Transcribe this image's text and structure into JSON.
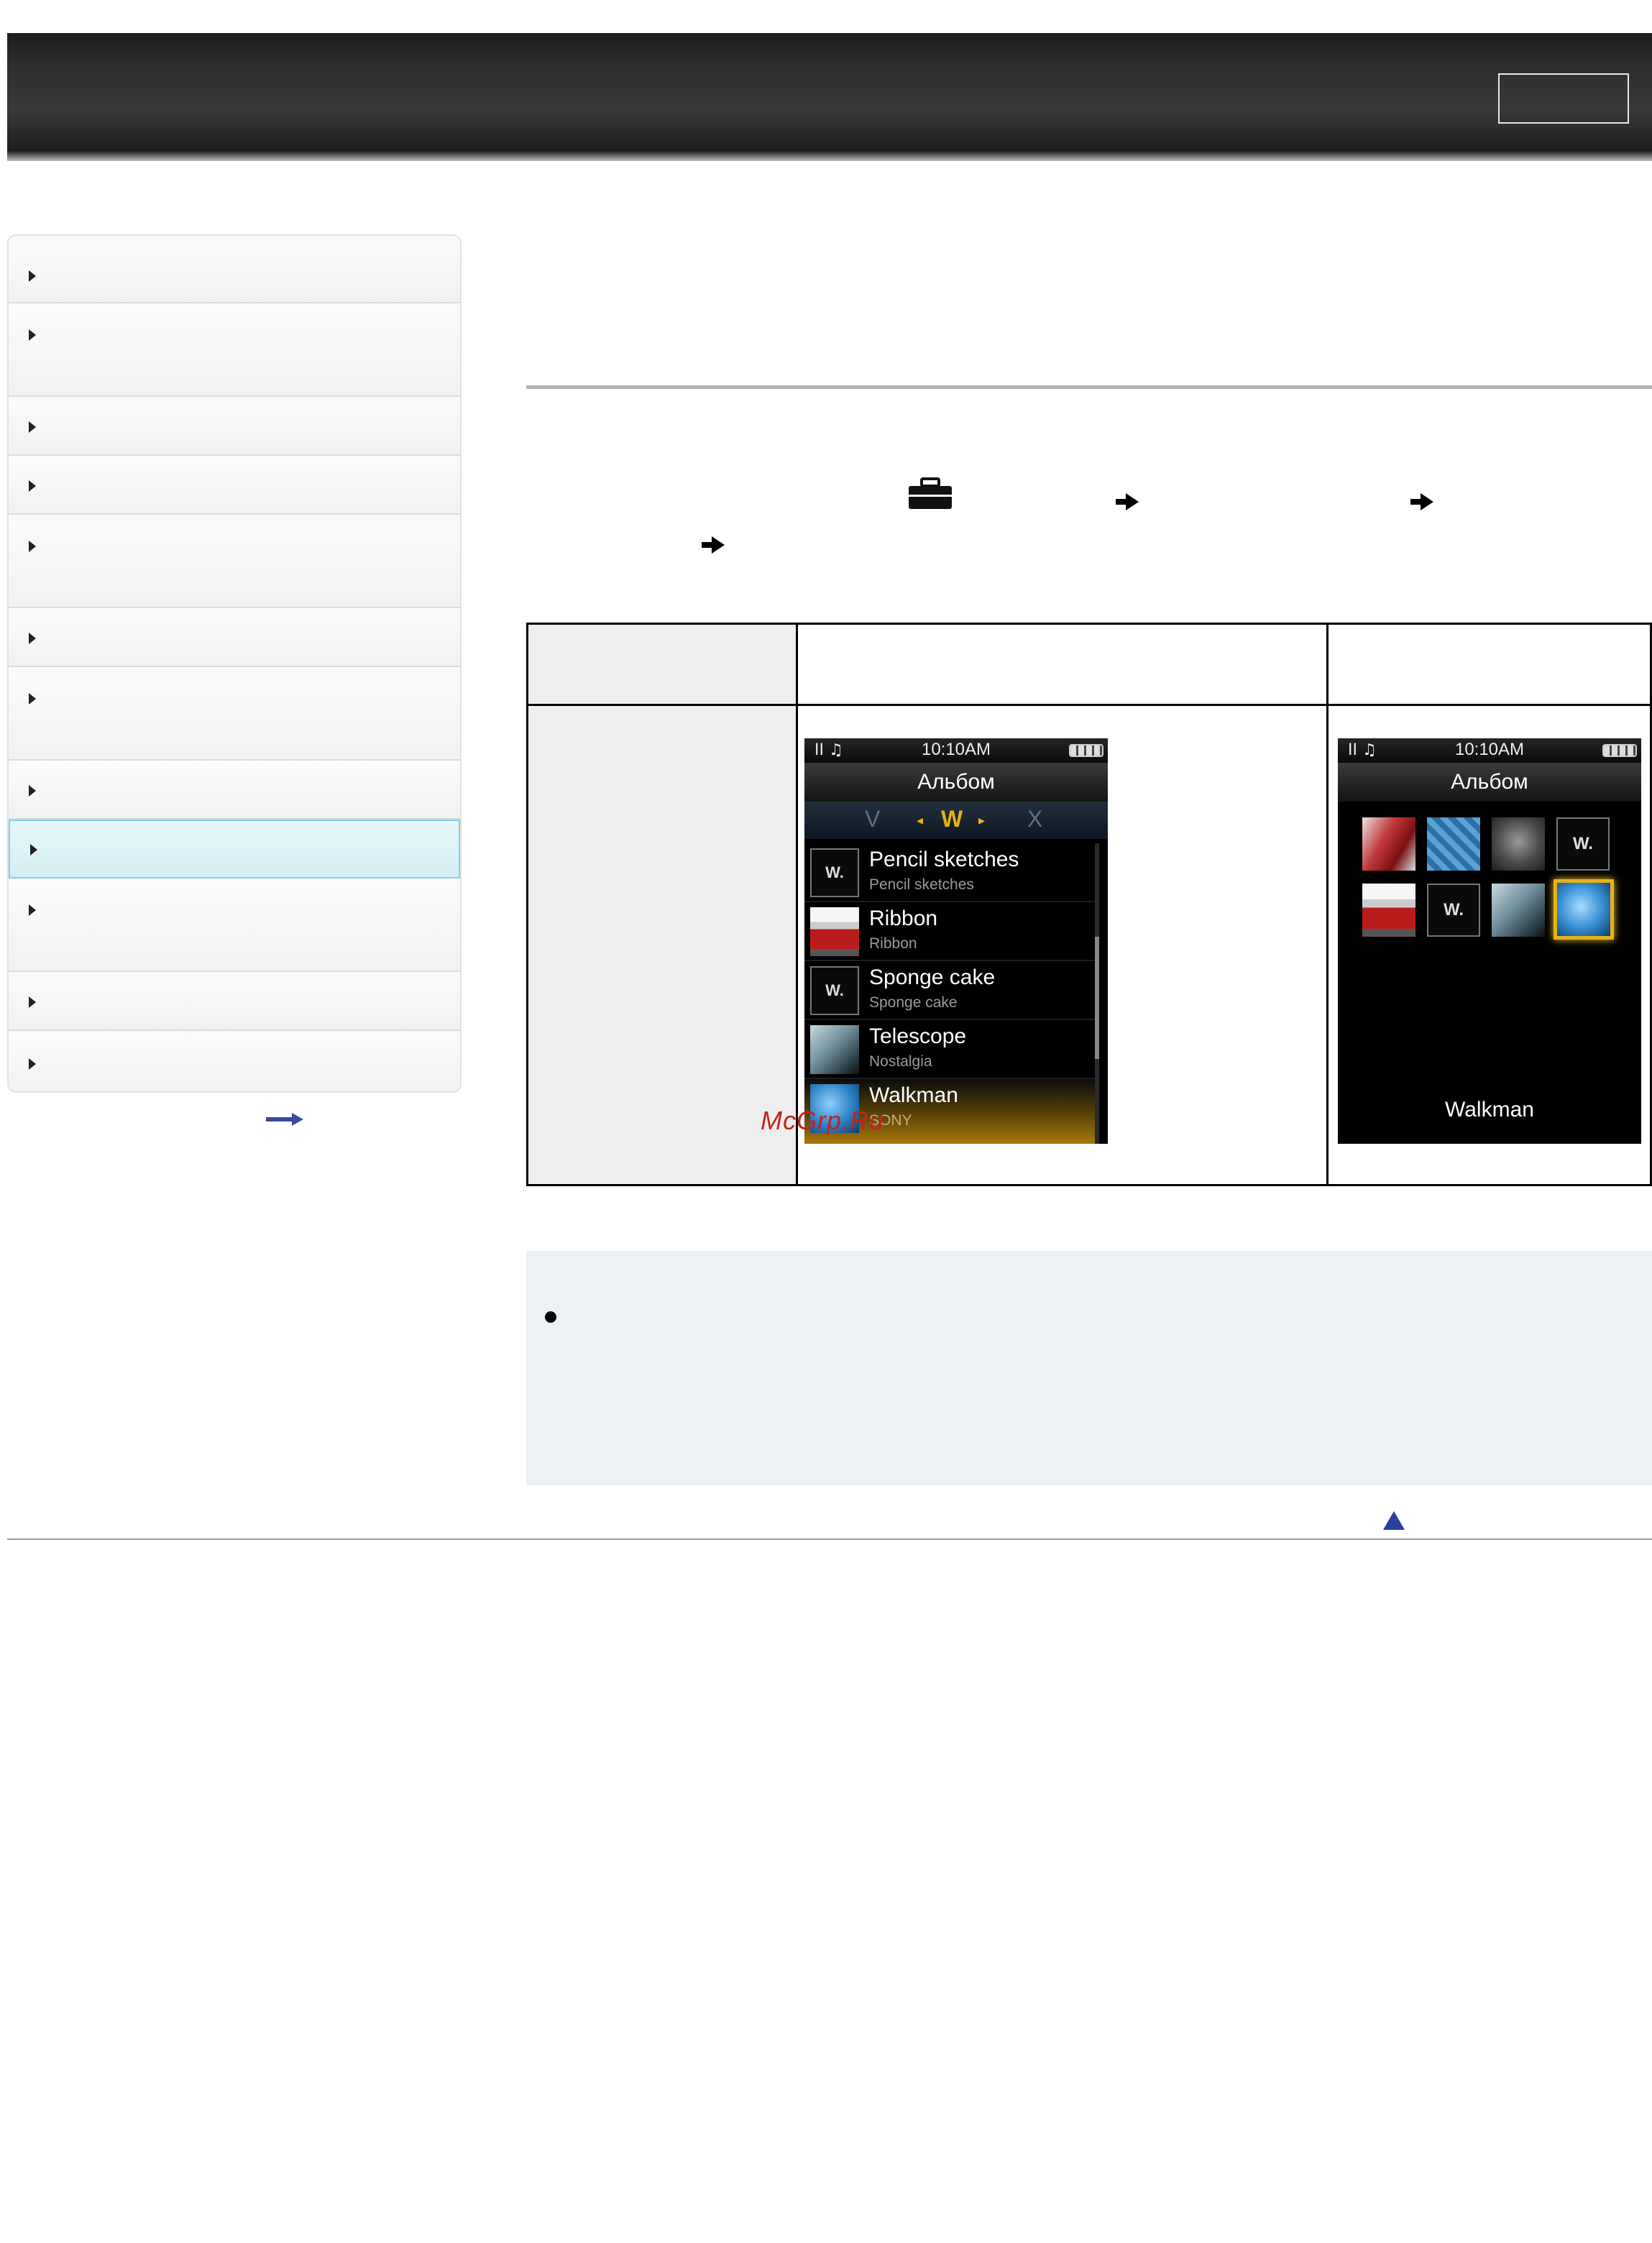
{
  "sidebar": {
    "item_count": 12,
    "active_index": 9
  },
  "screen_list": {
    "status_time": "10:10AM",
    "status_icons": "II ♫",
    "title": "Альбом",
    "alpha_prev": "V",
    "alpha_current": "W",
    "alpha_next": "X",
    "items": [
      {
        "title": "Pencil sketches",
        "sub": "Pencil sketches"
      },
      {
        "title": "Ribbon",
        "sub": "Ribbon"
      },
      {
        "title": "Sponge cake",
        "sub": "Sponge cake"
      },
      {
        "title": "Telescope",
        "sub": "Nostalgia"
      },
      {
        "title": "Walkman",
        "sub": "SONY"
      }
    ]
  },
  "screen_grid": {
    "status_time": "10:10AM",
    "status_icons": "II ♫",
    "title": "Альбом",
    "label": "Walkman"
  },
  "watermark": "McGrp.Ru",
  "colors": {
    "accent_active": "#7fd2ea",
    "selection": "#e5b21a",
    "header": "#2e2e2e"
  },
  "icons": [
    "toolbox-icon",
    "arrow-right-icon",
    "back-to-top-icon"
  ]
}
